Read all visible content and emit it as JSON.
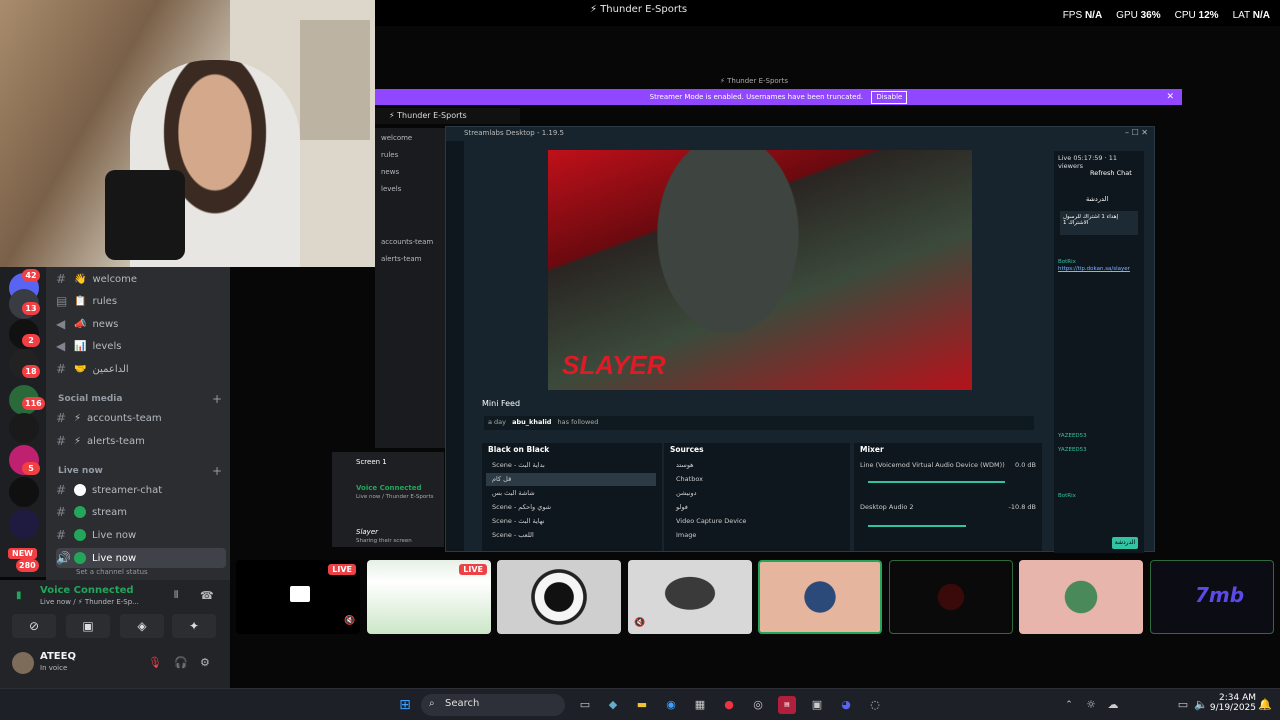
{
  "top": {
    "title": "⚡ Thunder E-Sports",
    "fps_label": "FPS",
    "fps_value": "N/A",
    "gpu_label": "GPU",
    "gpu_value": "36%",
    "cpu_label": "CPU",
    "cpu_value": "12%",
    "lat_label": "LAT",
    "lat_value": "N/A"
  },
  "servers": {
    "badges": [
      "42",
      "13",
      "2",
      "18",
      "116",
      "5",
      "280"
    ],
    "new_label": "NEW"
  },
  "channels": {
    "top": [
      {
        "emoji": "👋",
        "label": "welcome"
      },
      {
        "emoji": "📋",
        "label": "rules"
      },
      {
        "emoji": "📣",
        "label": "news"
      },
      {
        "emoji": "📊",
        "label": "levels"
      },
      {
        "emoji": "🤝",
        "label": "الداعمين"
      }
    ],
    "social_media_label": "Social media",
    "social": [
      {
        "emoji": "⚡",
        "label": "accounts-team"
      },
      {
        "emoji": "⚡",
        "label": "alerts-team"
      }
    ],
    "live_now_label": "Live now",
    "live": [
      {
        "label": "streamer-chat"
      },
      {
        "label": "stream"
      },
      {
        "label": "Live now"
      },
      {
        "label": "Live now"
      }
    ],
    "set_status": "Set a channel status"
  },
  "voice": {
    "title": "Voice Connected",
    "subtitle": "Live now / ⚡ Thunder E-Sp...",
    "username": "ATEEQ",
    "user_status": "In voice"
  },
  "obs": {
    "inner_title": "⚡ Thunder E-Sports",
    "banner_text": "Streamer Mode is enabled. Usernames have been truncated.",
    "banner_button": "Disable",
    "server_header": "⚡ Thunder E-Sports",
    "app_title": "Streamlabs Desktop - 1.19.5",
    "mini_feed_title": "Mini Feed",
    "feed_time": "a day",
    "feed_user": "abu_khalid",
    "feed_action": "has followed",
    "scenes_title": "Black on Black",
    "scenes": [
      "Scene - بداية البث",
      "قل كام",
      "شاشة البث بس",
      "Scene - شوي واحكم",
      "Scene - نهاية البث",
      "Scene - اللعب"
    ],
    "sources_title": "Sources",
    "sources": [
      "هوستد",
      "Chatbox",
      "دونيشن",
      "فولو",
      "Video Capture Device",
      "Image"
    ],
    "mixer_title": "Mixer",
    "mixer": [
      {
        "name": "Line (Voicemod Virtual Audio Device (WDM))",
        "db": "0.0 dB",
        "level": 0.98
      },
      {
        "name": "Desktop Audio 2",
        "db": "-10.8 dB",
        "level": 0.7
      }
    ],
    "preview_logo": "SLAYER"
  },
  "chat": {
    "live_time": "Live 05:17:59",
    "viewers": "11 viewers",
    "refresh": "Refresh Chat",
    "header": "الدردشة",
    "pinned": "إهداء 1 اشتراك للرسول الاشتراك 1",
    "bot_user": "BotRix",
    "link": "https://tip.dokan.sa/slayer",
    "user2": "YAZEED53",
    "send": "الدردشة"
  },
  "tiles": {
    "live_label": "LIVE",
    "screen_title": "Screen 1",
    "voice_connected": "Voice Connected",
    "voice_sub": "Live now / Thunder E-Sports",
    "slayer_name": "Slayer",
    "slayer_sub": "Sharing their screen",
    "tile_logo": "7mb"
  },
  "taskbar": {
    "search": "Search",
    "time": "2:34 AM",
    "date": "9/19/2025"
  }
}
